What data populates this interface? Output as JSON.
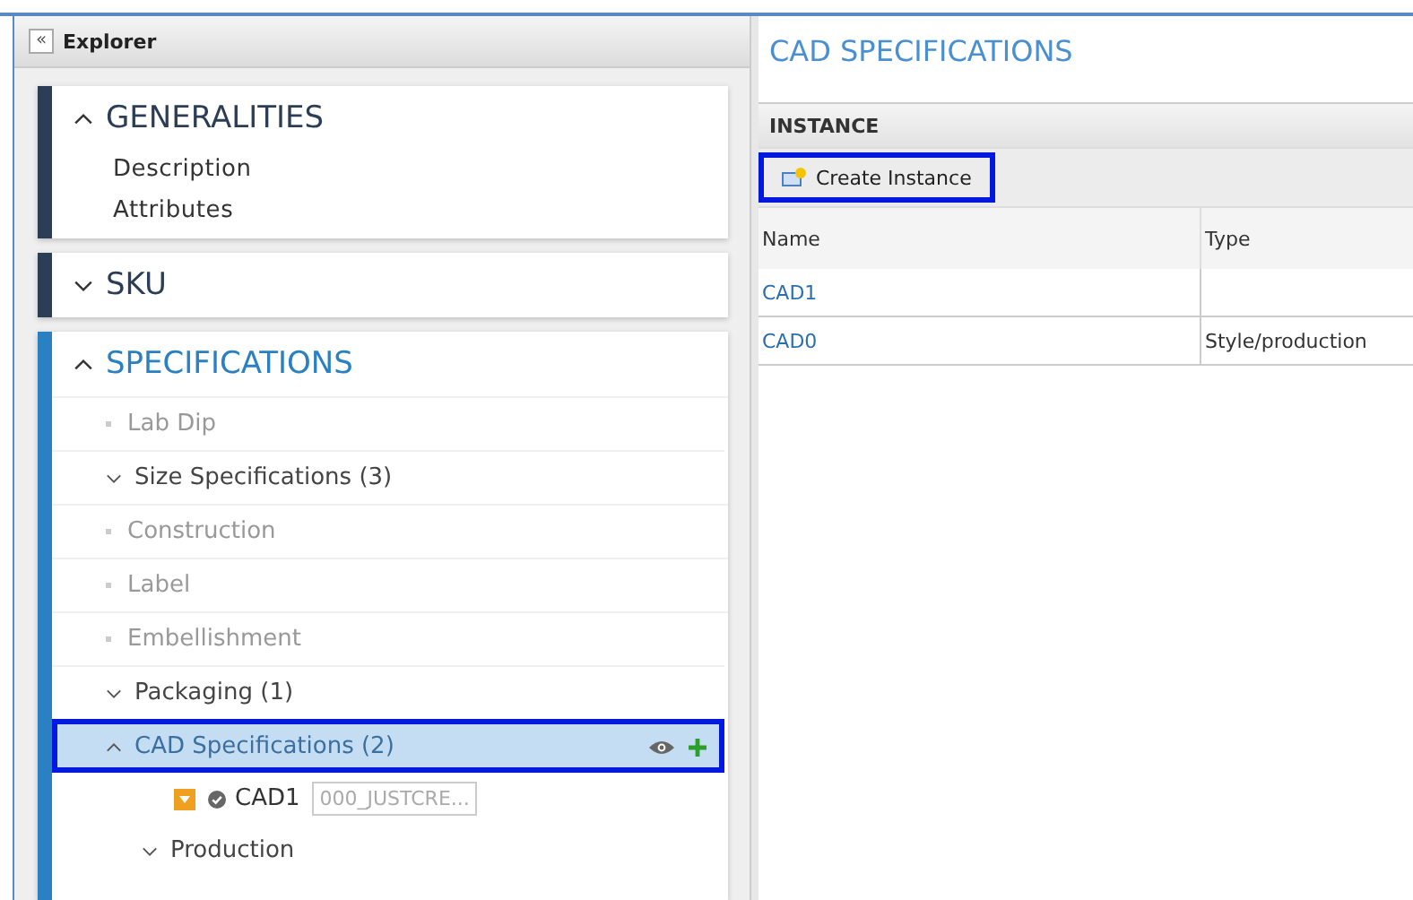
{
  "explorer": {
    "title": "Explorer",
    "collapse_icon": "«"
  },
  "sections": [
    {
      "title": "GENERALITIES",
      "expanded": true,
      "active": false,
      "items": [
        {
          "kind": "link",
          "label": "Description"
        },
        {
          "kind": "link",
          "label": "Attributes"
        }
      ]
    },
    {
      "title": "SKU",
      "expanded": false,
      "active": false
    },
    {
      "title": "SPECIFICATIONS",
      "expanded": true,
      "active": true,
      "items": [
        {
          "kind": "leaf",
          "label": "Lab Dip"
        },
        {
          "kind": "group",
          "label": "Size Specifications (3)",
          "expanded": false,
          "selected": false,
          "highlighted": false
        },
        {
          "kind": "leaf",
          "label": "Construction"
        },
        {
          "kind": "leaf",
          "label": "Label"
        },
        {
          "kind": "leaf",
          "label": "Embellishment"
        },
        {
          "kind": "group",
          "label": "Packaging (1)",
          "expanded": false,
          "selected": false,
          "highlighted": false
        },
        {
          "kind": "group",
          "label": "CAD Specifications (2)",
          "expanded": true,
          "selected": true,
          "highlighted": true,
          "children": [
            {
              "kind": "instance",
              "label": "CAD1",
              "value": "000_JUSTCRE..."
            },
            {
              "kind": "group",
              "label": "Production",
              "expanded": false,
              "selected": false,
              "highlighted": false
            }
          ]
        }
      ]
    }
  ],
  "detail": {
    "title": "CAD SPECIFICATIONS",
    "section": "INSTANCE",
    "create_button": {
      "label": "Create Instance",
      "highlighted": true
    },
    "table": {
      "columns": [
        "Name",
        "Type"
      ],
      "rows": [
        [
          "CAD1",
          ""
        ],
        [
          "CAD0",
          "Style/production"
        ]
      ]
    }
  }
}
